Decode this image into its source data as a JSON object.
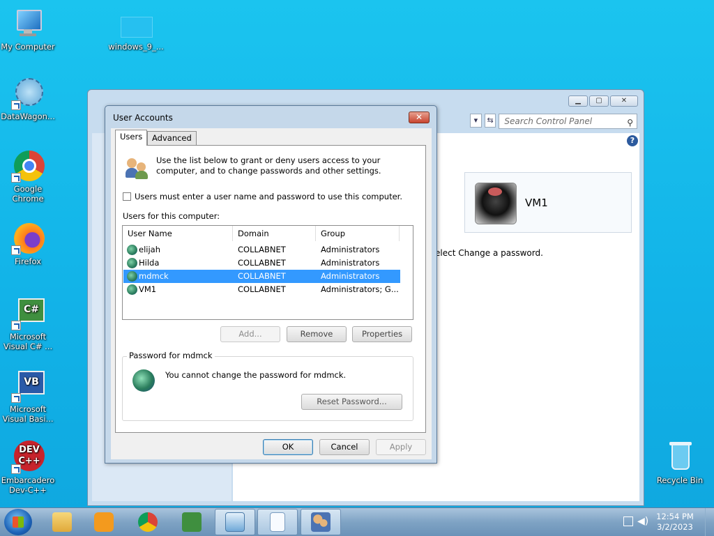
{
  "desktop": {
    "icons": [
      {
        "label": "My Computer"
      },
      {
        "label": "windows_9_..."
      },
      {
        "label": "DataWagon..."
      },
      {
        "label": "Google Chrome"
      },
      {
        "label": "Firefox"
      },
      {
        "label": "Microsoft Visual C# ..."
      },
      {
        "label": "Microsoft Visual Basi..."
      },
      {
        "label": "Embarcadero Dev-C++"
      },
      {
        "label": "Recycle Bin"
      }
    ]
  },
  "control_panel": {
    "search_placeholder": "Search Control Panel",
    "account_name": "VM1",
    "partial_text": "elect Change a password."
  },
  "dialog": {
    "title": "User Accounts",
    "close_label": "✕",
    "tabs": [
      {
        "label": "Users"
      },
      {
        "label": "Advanced"
      }
    ],
    "intro": "Use the list below to grant or deny users access to your computer, and to change passwords and other settings.",
    "must_login_label": "Users must enter a user name and password to use this computer.",
    "must_login_checked": false,
    "users_label": "Users for this computer:",
    "columns": [
      "User Name",
      "Domain",
      "Group"
    ],
    "users": [
      {
        "name": "elijah",
        "domain": "COLLABNET",
        "group": "Administrators"
      },
      {
        "name": "Hilda",
        "domain": "COLLABNET",
        "group": "Administrators"
      },
      {
        "name": "mdmck",
        "domain": "COLLABNET",
        "group": "Administrators"
      },
      {
        "name": "VM1",
        "domain": "COLLABNET",
        "group": "Administrators; G..."
      }
    ],
    "selected_user_index": 2,
    "buttons": {
      "add": "Add...",
      "remove": "Remove",
      "properties": "Properties"
    },
    "password_group": {
      "legend": "Password for mdmck",
      "message": "You cannot change the password for mdmck.",
      "reset_button": "Reset Password..."
    },
    "footer": {
      "ok": "OK",
      "cancel": "Cancel",
      "apply": "Apply"
    }
  },
  "taskbar": {
    "time": "12:54 PM",
    "date": "3/2/2023"
  }
}
